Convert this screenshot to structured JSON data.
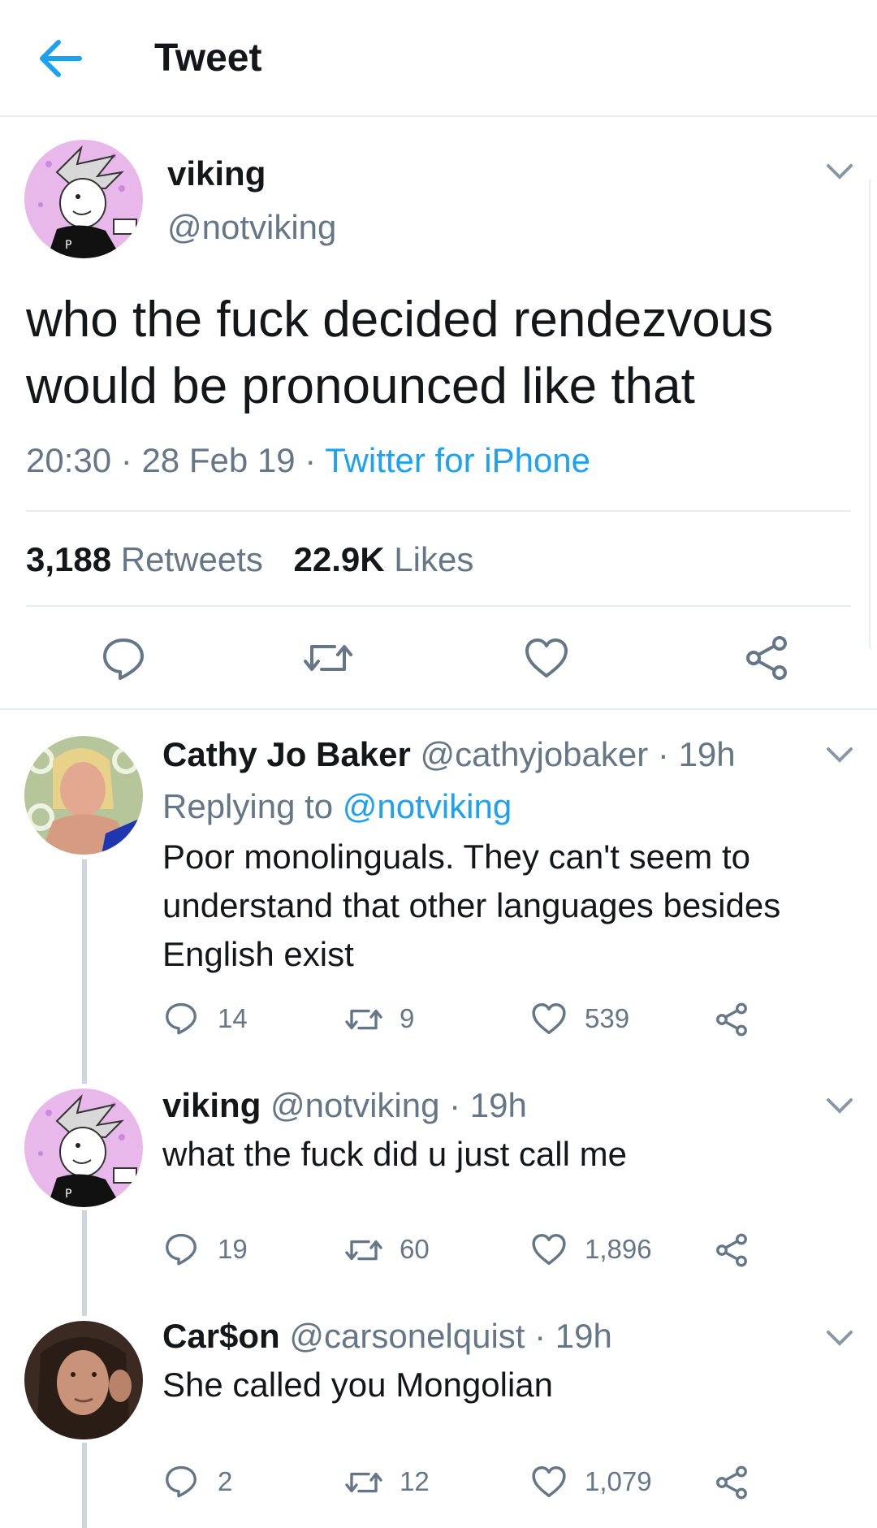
{
  "header": {
    "title": "Tweet"
  },
  "tweet": {
    "name": "viking",
    "handle": "@notviking",
    "text_line1": "who the fuck decided rendezvous",
    "text_line2": "would be pronounced like that",
    "time": "20:30",
    "sep1": "·",
    "date": "28 Feb 19",
    "sep2": "·",
    "source": "Twitter for iPhone",
    "retweets_count": "3,188",
    "retweets_label": "Retweets",
    "likes_count": "22.9K",
    "likes_label": "Likes"
  },
  "replies": [
    {
      "name": "Cathy Jo Baker",
      "meta": "@cathyjobaker · 19h",
      "replying_label": "Replying to",
      "replying_to": "@notviking",
      "line1": "Poor monolinguals. They can't seem to",
      "line2": "understand that other languages besides",
      "line3": "English exist",
      "replies": "14",
      "retweets": "9",
      "likes": "539"
    },
    {
      "name": "viking",
      "meta": "@notviking · 19h",
      "line1": "what the fuck did u just call me",
      "replies": "19",
      "retweets": "60",
      "likes": "1,896"
    },
    {
      "name": "Car$on",
      "meta": "@carsonelquist · 19h",
      "line1": "She called you Mongolian",
      "replies": "2",
      "retweets": "12",
      "likes": "1,079"
    }
  ],
  "colors": {
    "accent": "#1da1f2",
    "muted": "#657786",
    "divider": "#e6ecf0"
  }
}
